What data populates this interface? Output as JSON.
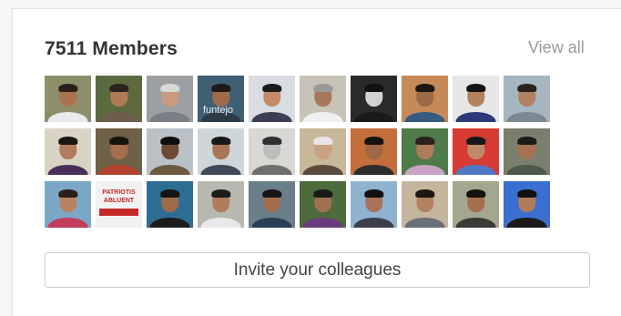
{
  "panel": {
    "member_count": "7511",
    "members_label": "Members",
    "view_all_label": "View all",
    "invite_label": "Invite your colleagues"
  },
  "members": [
    {
      "icon": "member-avatar-photo",
      "bg": "#8c8f6a",
      "skin": "#a9714e",
      "shirt": "#e9e9e9",
      "hair": "#2a1f18"
    },
    {
      "icon": "member-avatar-photo",
      "bg": "#5b6b3f",
      "skin": "#b07a55",
      "shirt": "#6d5d4a",
      "hair": "#2b2420"
    },
    {
      "icon": "member-avatar-photo",
      "bg": "#9da0a3",
      "skin": "#c89a80",
      "shirt": "#7a7f86",
      "hair": "#d8d8d8"
    },
    {
      "icon": "member-avatar-photo",
      "bg": "#3f5f74",
      "skin": "#a06b4c",
      "shirt": "#2d3b46",
      "hair": "#1f1a17",
      "caption": "funtejo"
    },
    {
      "icon": "member-avatar-photo",
      "bg": "#d9dde2",
      "skin": "#c28a66",
      "shirt": "#3a3f55",
      "hair": "#1c1c1c"
    },
    {
      "icon": "member-avatar-photo",
      "bg": "#c7c3b6",
      "skin": "#a9785a",
      "shirt": "#f0f0f0",
      "hair": "#9a9a9a"
    },
    {
      "icon": "member-avatar-photo",
      "bg": "#2a2a2a",
      "skin": "#d2d2d2",
      "shirt": "#1a1a1a",
      "hair": "#111111"
    },
    {
      "icon": "member-avatar-photo",
      "bg": "#c58a57",
      "skin": "#9b6a48",
      "shirt": "#375b7e",
      "hair": "#1c1712"
    },
    {
      "icon": "member-avatar-photo",
      "bg": "#e7e7e7",
      "skin": "#b5825f",
      "shirt": "#2b3a78",
      "hair": "#141414"
    },
    {
      "icon": "member-avatar-photo",
      "bg": "#a5b6c1",
      "skin": "#b18061",
      "shirt": "#7b8a91",
      "hair": "#2a2320"
    },
    {
      "icon": "member-avatar-photo",
      "bg": "#d9d3c4",
      "skin": "#b07c5c",
      "shirt": "#4a2f5a",
      "hair": "#1a1714"
    },
    {
      "icon": "member-avatar-photo",
      "bg": "#6f6048",
      "skin": "#a46e4f",
      "shirt": "#b4412f",
      "hair": "#17130f"
    },
    {
      "icon": "member-avatar-photo",
      "bg": "#b9c1c6",
      "skin": "#6e4a35",
      "shirt": "#6b5a3d",
      "hair": "#110d0b"
    },
    {
      "icon": "member-avatar-photo",
      "bg": "#cfd6da",
      "skin": "#a97657",
      "shirt": "#3f4a57",
      "hair": "#1a1a1a"
    },
    {
      "icon": "member-avatar-photo",
      "bg": "#d9d7d3",
      "skin": "#bdbdbd",
      "shirt": "#6f6f6f",
      "hair": "#303030"
    },
    {
      "icon": "member-avatar-photo",
      "bg": "#c9b79a",
      "skin": "#caa283",
      "shirt": "#5a4b3f",
      "hair": "#e6e6e6"
    },
    {
      "icon": "member-avatar-photo",
      "bg": "#c46e3b",
      "skin": "#9f6847",
      "shirt": "#2e2e2e",
      "hair": "#18120e"
    },
    {
      "icon": "member-avatar-photo",
      "bg": "#4f7a49",
      "skin": "#b07b5b",
      "shirt": "#c9a3c6",
      "hair": "#2a2120"
    },
    {
      "icon": "member-avatar-photo",
      "bg": "#d73b34",
      "skin": "#c08a69",
      "shirt": "#5079c4",
      "hair": "#171717"
    },
    {
      "icon": "member-avatar-photo",
      "bg": "#7a7f6d",
      "skin": "#a77252",
      "shirt": "#4b5a47",
      "hair": "#1d1a17"
    },
    {
      "icon": "member-avatar-photo",
      "bg": "#7aa7c6",
      "skin": "#b78363",
      "shirt": "#c23c5d",
      "hair": "#2b1f1a"
    },
    {
      "icon": "member-avatar-photo",
      "bg": "#f1f1f1",
      "skin": "#f1f1f1",
      "shirt": "#e3e3e3",
      "hair": "#f1f1f1",
      "poster": "PATRIOTIS ABLUENT"
    },
    {
      "icon": "member-avatar-photo",
      "bg": "#2e6d93",
      "skin": "#a06a4a",
      "shirt": "#1c1c1c",
      "hair": "#141414"
    },
    {
      "icon": "member-avatar-photo",
      "bg": "#b8b7b0",
      "skin": "#b07c5c",
      "shirt": "#e9e9e9",
      "hair": "#1c1c1c"
    },
    {
      "icon": "member-avatar-photo",
      "bg": "#6b7f8a",
      "skin": "#a16e50",
      "shirt": "#273f55",
      "hair": "#161616"
    },
    {
      "icon": "member-avatar-photo",
      "bg": "#4d6b3d",
      "skin": "#a16f51",
      "shirt": "#6a3c7d",
      "hair": "#1c1a18"
    },
    {
      "icon": "member-avatar-photo",
      "bg": "#8fb2d1",
      "skin": "#a9735a",
      "shirt": "#3c3f4a",
      "hair": "#121212"
    },
    {
      "icon": "member-avatar-photo",
      "bg": "#c6b59d",
      "skin": "#b2815f",
      "shirt": "#6b6f76",
      "hair": "#1a1613"
    },
    {
      "icon": "member-avatar-photo",
      "bg": "#a4a68f",
      "skin": "#a46f4c",
      "shirt": "#3b3a36",
      "hair": "#141210"
    },
    {
      "icon": "member-avatar-photo",
      "bg": "#3a6fd1",
      "skin": "#b07b5a",
      "shirt": "#1a1a1a",
      "hair": "#111111"
    }
  ]
}
